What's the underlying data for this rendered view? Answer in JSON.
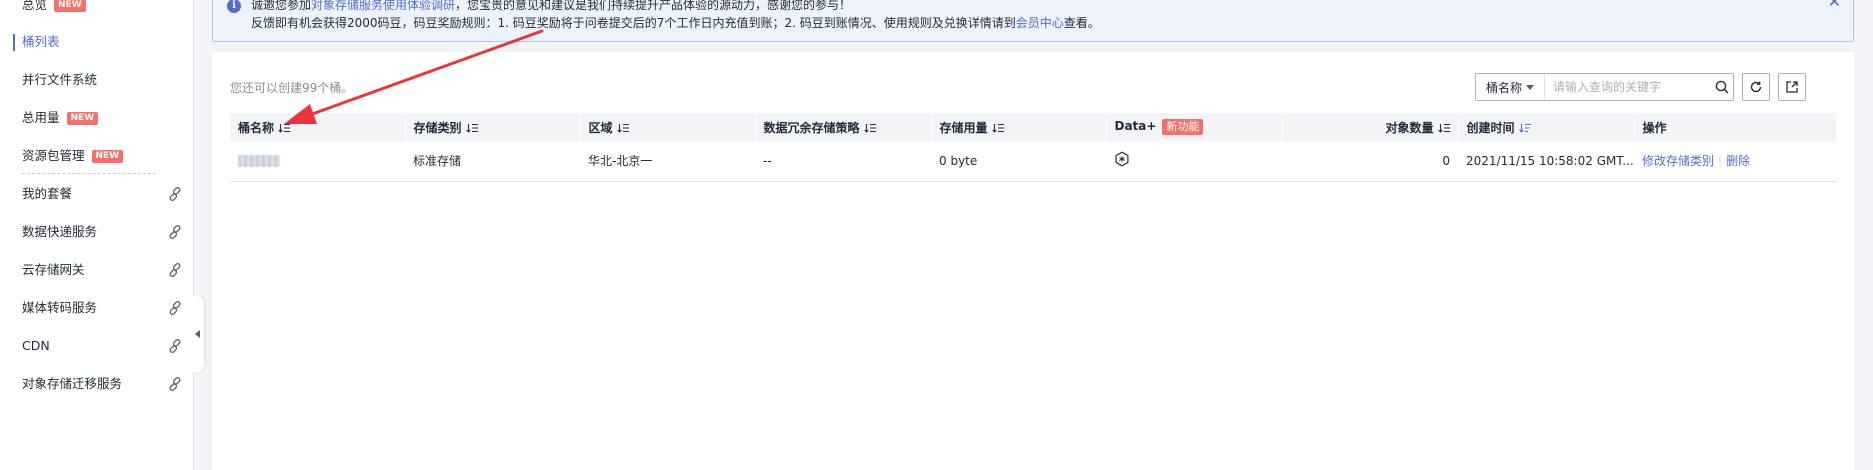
{
  "sidebar": {
    "items": [
      {
        "label": "总览",
        "badge": "NEW"
      },
      {
        "label": "桶列表",
        "active": true
      },
      {
        "label": "并行文件系统"
      },
      {
        "label": "总用量",
        "badge": "NEW"
      },
      {
        "label": "资源包管理",
        "badge": "NEW"
      },
      {
        "label": "我的套餐",
        "external": true
      },
      {
        "label": "数据快递服务",
        "external": true
      },
      {
        "label": "云存储网关",
        "external": true
      },
      {
        "label": "媒体转码服务",
        "external": true
      },
      {
        "label": "CDN",
        "external": true
      },
      {
        "label": "对象存储迁移服务",
        "external": true
      }
    ]
  },
  "notice": {
    "line1_prefix": "诚邀您参加",
    "line1_link": "对象存储服务使用体验调研",
    "line1_suffix": "，您宝贵的意见和建议是我们持续提升产品体验的源动力，感谢您的参与！",
    "line2_prefix": "反馈即有机会获得2000码豆，码豆奖励规则：1. 码豆奖励将于问卷提交后的7个工作日内充值到账；2. 码豆到账情况、使用规则及兑换详情请到",
    "line2_link": "会员中心",
    "line2_suffix": "查看。",
    "close_symbol": "✕"
  },
  "main": {
    "quota_text": "您还可以创建99个桶。",
    "search": {
      "field_label": "桶名称",
      "placeholder": "请输入查询的关键字"
    }
  },
  "table": {
    "headers": {
      "name": "桶名称",
      "storage_class": "存储类别",
      "region": "区域",
      "redundancy": "数据冗余存储策略",
      "usage": "存储用量",
      "data_plus": "Data+",
      "data_plus_tag": "新功能",
      "object_count": "对象数量",
      "created": "创建时间",
      "ops": "操作"
    },
    "rows": [
      {
        "storage_class": "标准存储",
        "region": "华北-北京一",
        "redundancy": "--",
        "usage": "0 byte",
        "object_count": "0",
        "created": "2021/11/15 10:58:02 GMT...",
        "op_modify": "修改存储类别",
        "op_delete": "删除"
      }
    ]
  },
  "colors": {
    "accent": "#526ecc",
    "badge": "#f66f6a",
    "annotation_arrow": "#e8353b"
  }
}
